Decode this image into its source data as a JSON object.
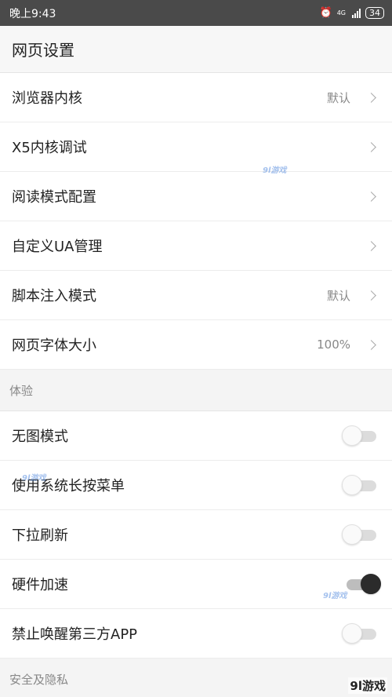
{
  "status_bar": {
    "time": "晚上9:43",
    "alarm_icon": "alarm-clock-icon",
    "network": "4G",
    "battery": "34"
  },
  "header": {
    "title": "网页设置"
  },
  "settings": [
    {
      "label": "浏览器内核",
      "value": "默认"
    },
    {
      "label": "X5内核调试",
      "value": ""
    },
    {
      "label": "阅读模式配置",
      "value": ""
    },
    {
      "label": "自定义UA管理",
      "value": ""
    },
    {
      "label": "脚本注入模式",
      "value": "默认"
    },
    {
      "label": "网页字体大小",
      "value": "100%"
    }
  ],
  "experience": {
    "title": "体验",
    "toggles": [
      {
        "label": "无图模式",
        "on": false
      },
      {
        "label": "使用系统长按菜单",
        "on": false
      },
      {
        "label": "下拉刷新",
        "on": false
      },
      {
        "label": "硬件加速",
        "on": true
      },
      {
        "label": "禁止唤醒第三方APP",
        "on": false
      }
    ]
  },
  "privacy": {
    "title": "安全及隐私"
  },
  "watermark": {
    "logo": "9l游戏",
    "mark": "9l游戏"
  },
  "colors": {
    "status_bar": "#4a4a4a",
    "toggle_on_knob": "#2b2b2b",
    "toggle_off_knob": "#fafafa"
  }
}
